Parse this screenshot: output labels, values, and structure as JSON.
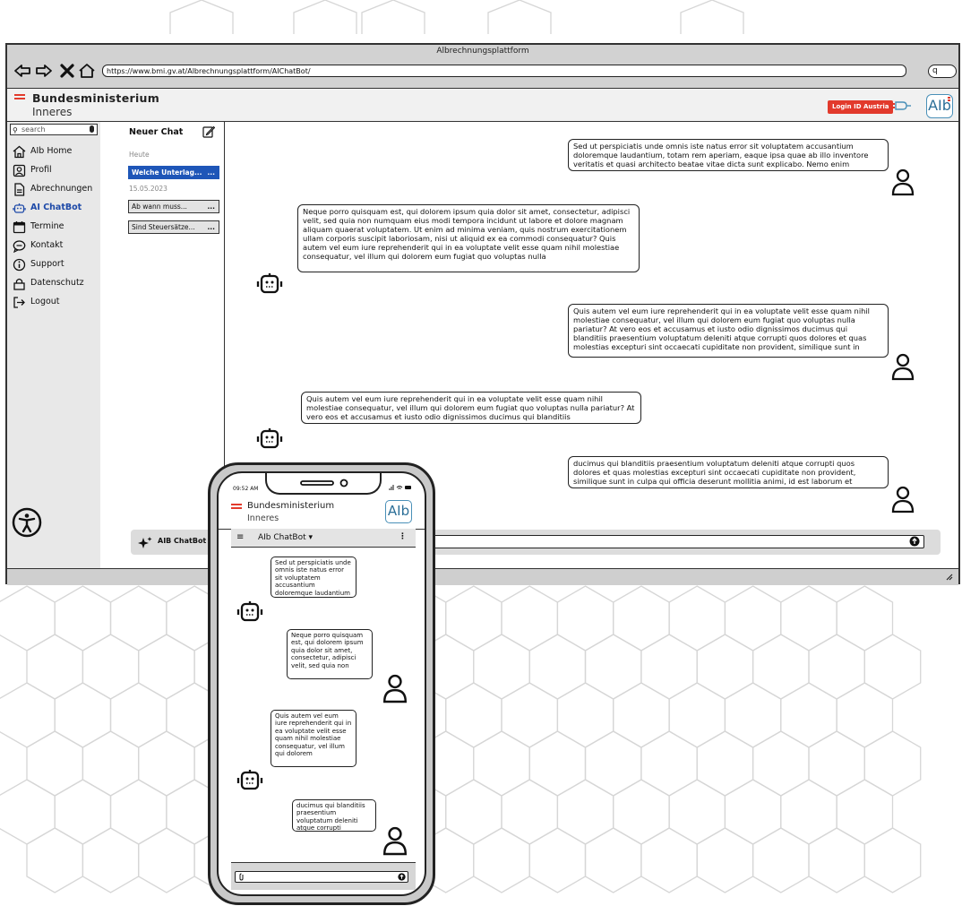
{
  "browser": {
    "window_title": "Albrechnungsplattform",
    "url": "https://www.bmi.gv.at/Albrechnungsplattform/AIChatBot/",
    "nav_icons": [
      "back-icon",
      "forward-icon",
      "close-icon",
      "home-icon"
    ],
    "search_glyph": "q"
  },
  "header": {
    "logo_line1": "Bundesministerium",
    "logo_line2": "Inneres",
    "login_label": "Login ID Austria",
    "app_logo": "AIb"
  },
  "sidebar": {
    "search_placeholder": "search",
    "items": [
      {
        "label": "AIb Home",
        "icon": "home-icon"
      },
      {
        "label": "Profil",
        "icon": "profile-icon"
      },
      {
        "label": "Abrechnungen",
        "icon": "document-icon"
      },
      {
        "label": "AI ChatBot",
        "icon": "robot-icon",
        "active": true
      },
      {
        "label": "Termine",
        "icon": "calendar-icon"
      },
      {
        "label": "Kontakt",
        "icon": "chat-bubble-icon"
      },
      {
        "label": "Support",
        "icon": "info-icon"
      },
      {
        "label": "Datenschutz",
        "icon": "lock-icon"
      },
      {
        "label": "Logout",
        "icon": "logout-icon"
      }
    ]
  },
  "chatlist": {
    "new_chat": "Neuer Chat",
    "groups": [
      {
        "date": "Heute",
        "chats": [
          {
            "label": "Welche Unterlag...",
            "selected": true
          }
        ]
      },
      {
        "date": "15.05.2023",
        "chats": [
          {
            "label": "Ab wann muss..."
          },
          {
            "label": "Sind Steuersätze..."
          }
        ]
      }
    ],
    "more_label": "..."
  },
  "messages": [
    {
      "role": "user",
      "text": "Sed ut perspiciatis unde omnis iste natus error sit voluptatem accusantium doloremque laudantium, totam rem aperiam, eaque ipsa quae ab illo inventore veritatis et quasi architecto beatae vitae dicta sunt explicabo. Nemo enim"
    },
    {
      "role": "bot",
      "text": "Neque porro quisquam est, qui dolorem ipsum quia dolor sit amet, consectetur, adipisci velit, sed quia non numquam eius modi tempora incidunt ut labore et dolore magnam aliquam quaerat voluptatem. Ut enim ad minima veniam, quis nostrum exercitationem ullam corporis suscipit laboriosam, nisi ut aliquid ex ea commodi consequatur? Quis autem vel eum iure reprehenderit qui in ea voluptate velit esse quam nihil molestiae consequatur, vel illum qui dolorem eum fugiat quo voluptas nulla"
    },
    {
      "role": "user",
      "text": "Quis autem vel eum iure reprehenderit qui in ea voluptate velit esse quam nihil molestiae consequatur, vel illum qui dolorem eum fugiat quo voluptas nulla pariatur? At vero eos et accusamus et iusto odio dignissimos ducimus qui blanditiis praesentium voluptatum deleniti atque corrupti quos dolores et quas molestias excepturi sint occaecati cupiditate non provident, similique sunt in"
    },
    {
      "role": "bot",
      "text": "Quis autem vel eum iure reprehenderit qui in ea voluptate velit esse quam nihil molestiae consequatur, vel illum qui dolorem eum fugiat quo voluptas nulla pariatur? At vero eos et accusamus et iusto odio dignissimos ducimus qui blanditiis"
    },
    {
      "role": "user",
      "text": "ducimus qui blanditiis praesentium voluptatum deleniti atque corrupti quos dolores et quas molestias excepturi sint occaecati cupiditate non provident, similique sunt in culpa qui officia deserunt mollitia animi, id est laborum et"
    }
  ],
  "composer": {
    "label": "AIB ChatBot"
  },
  "phone": {
    "time": "09:52 AM",
    "logo_line1": "Bundesministerium",
    "logo_line2": "Inneres",
    "app_logo": "AIb",
    "bar_title": "AIb ChatBot",
    "messages": [
      {
        "role": "bot",
        "text": "Sed ut perspiciatis unde omnis iste natus error sit voluptatem accusantium doloremque laudantium"
      },
      {
        "role": "user",
        "text": "Neque porro quisquam est, qui dolorem ipsum quia dolor sit amet, consectetur, adipisci velit, sed quia non"
      },
      {
        "role": "bot",
        "text": "Quis autem vel eum iure reprehenderit qui in ea voluptate velit esse quam nihil molestiae consequatur, vel illum qui dolorem"
      },
      {
        "role": "user",
        "text": "ducimus qui blanditiis praesentium voluptatum deleniti atque corrupti"
      }
    ]
  },
  "colors": {
    "accent_red": "#e23a2c",
    "selected_blue": "#1e56b8",
    "logo_blue": "#2c6f98"
  }
}
